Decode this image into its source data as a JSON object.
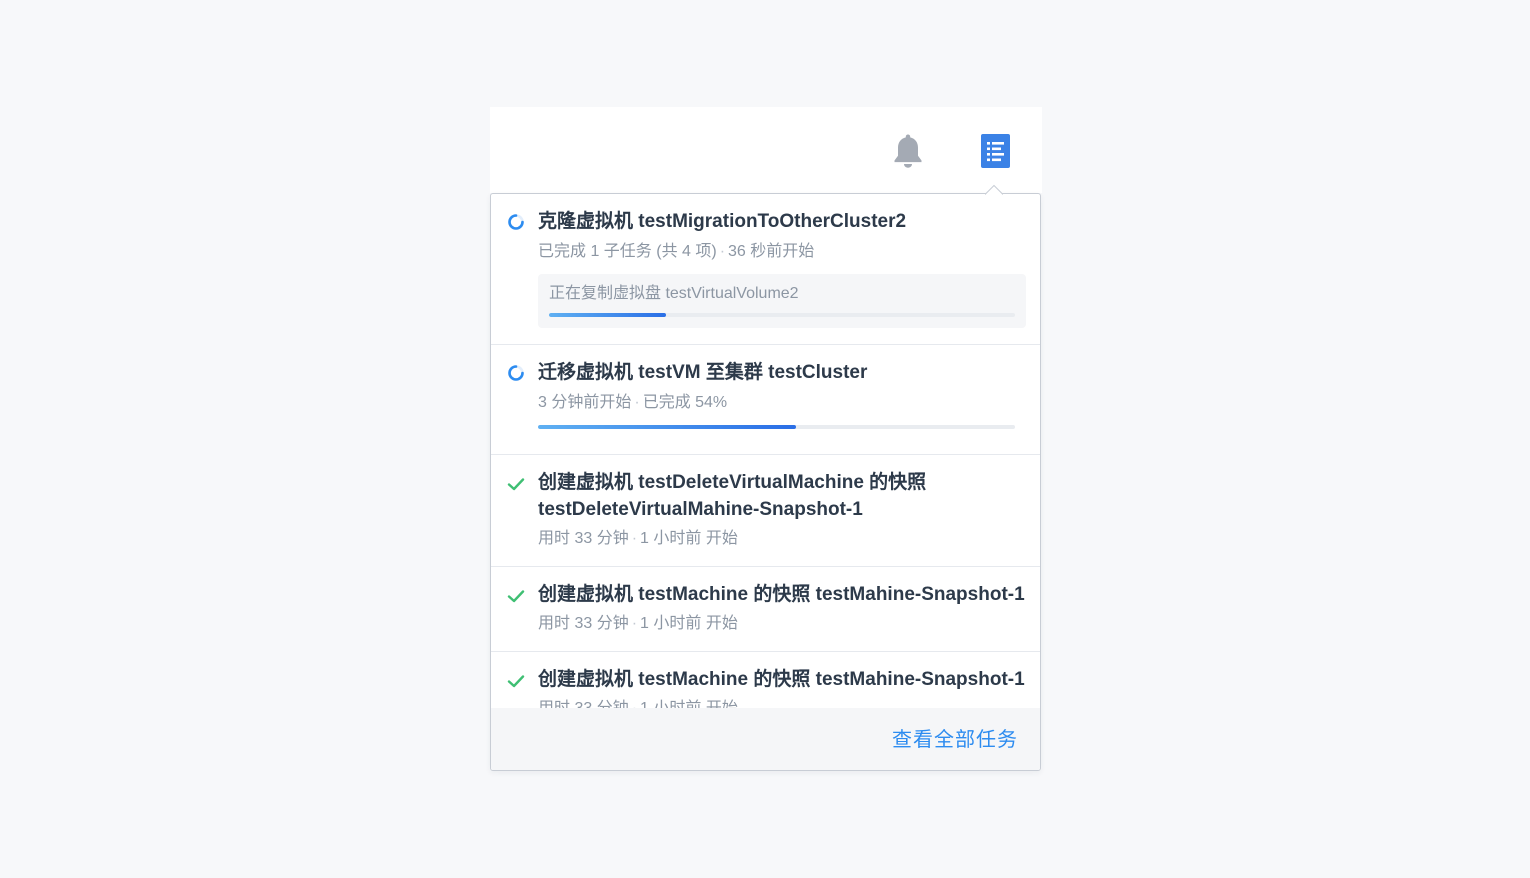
{
  "header": {
    "notifications_icon": "bell-icon",
    "tasks_icon": "task-list-icon",
    "accent": "#2d8cf0",
    "icon_active": "#3b82e6",
    "icon_inactive": "#a4aab4"
  },
  "tasks": [
    {
      "status": "running",
      "status_icon": "spinner-icon",
      "title": "克隆虚拟机 testMigrationToOtherCluster2",
      "meta_a": "已完成 1 子任务 (共 4 项)",
      "meta_b": "36 秒前开始",
      "subtask": {
        "label": "正在复制虚拟盘 testVirtualVolume2",
        "progress": 0.25
      }
    },
    {
      "status": "running",
      "status_icon": "spinner-icon",
      "title": "迁移虚拟机 testVM 至集群 testCluster",
      "meta_a": "3 分钟前开始",
      "meta_b": "已完成 54%",
      "progress": 0.54
    },
    {
      "status": "done",
      "status_icon": "check-icon",
      "title_line1": "创建虚拟机 testDeleteVirtualMachine 的快照",
      "title_line2": "testDeleteVirtualMahine-Snapshot-1",
      "meta_a": "用时 33 分钟",
      "meta_b": "1 小时前 开始"
    },
    {
      "status": "done",
      "status_icon": "check-icon",
      "title": "创建虚拟机 testMachine 的快照 testMahine-Snapshot-1",
      "meta_a": "用时 33 分钟",
      "meta_b": "1 小时前 开始"
    },
    {
      "status": "done",
      "status_icon": "check-icon",
      "title": "创建虚拟机 testMachine 的快照 testMahine-Snapshot-1",
      "meta_a": "用时 33 分钟",
      "meta_b": "1 小时前 开始"
    }
  ],
  "footer": {
    "view_all_label": "查看全部任务"
  },
  "colors": {
    "success": "#3fbf73",
    "spinner": "#2d8cf0",
    "progress_start": "#5fb0f2",
    "progress_end": "#2a6ee6"
  }
}
